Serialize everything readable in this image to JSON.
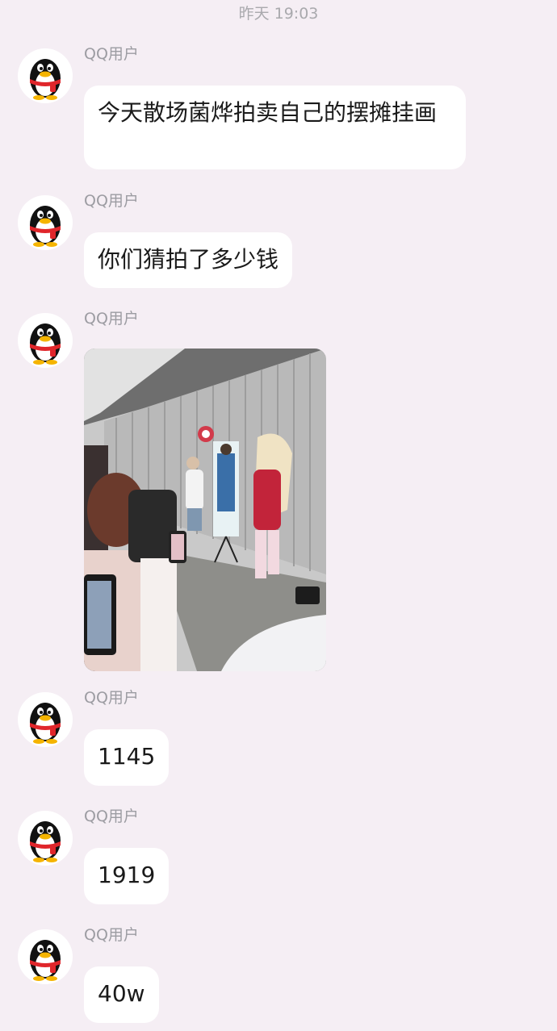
{
  "timestamp": "昨天 19:03",
  "messages": [
    {
      "sender": "QQ用户",
      "type": "text",
      "text": "今天散场菌烨拍卖自己的摆摊挂画"
    },
    {
      "sender": "QQ用户",
      "type": "text",
      "text": "你们猜拍了多少钱"
    },
    {
      "sender": "QQ用户",
      "type": "image"
    },
    {
      "sender": "QQ用户",
      "type": "text",
      "text": "1145"
    },
    {
      "sender": "QQ用户",
      "type": "text",
      "text": "1919"
    },
    {
      "sender": "QQ用户",
      "type": "text",
      "text": "40w"
    }
  ],
  "colors": {
    "background": "#f5eef4",
    "bubble": "#ffffff",
    "sender_name": "#9c9ca2",
    "timestamp": "#a9a9ad",
    "avatar_scarf": "#e0262b"
  },
  "icons": {
    "avatar": "qq-penguin-icon"
  }
}
